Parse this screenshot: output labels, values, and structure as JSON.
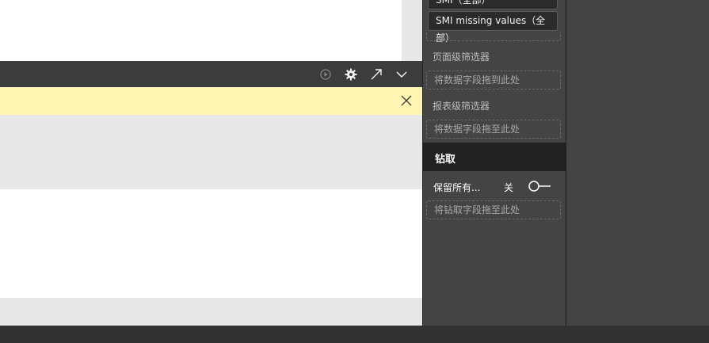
{
  "filters": {
    "chips": [
      "SMI（全部）",
      "SMI missing values（全部）"
    ],
    "page_level_label": "页面级筛选器",
    "page_level_dropzone": "将数据字段拖到此处",
    "report_level_label": "报表级筛选器",
    "report_level_dropzone": "将数据字段拖至此处"
  },
  "drill": {
    "title": "钻取",
    "keep_all_label": "保留所有...",
    "toggle_state": "关",
    "dropzone": "将钻取字段拖至此处"
  },
  "icons": {
    "header": [
      "play-circle-icon",
      "gear-icon",
      "expand-arrow-icon",
      "chevron-down-icon"
    ],
    "warning": "close-icon"
  },
  "colors": {
    "warning_bg": "#fff6b3",
    "pane_bg": "#444444",
    "header_bg": "#3c3c3c"
  }
}
